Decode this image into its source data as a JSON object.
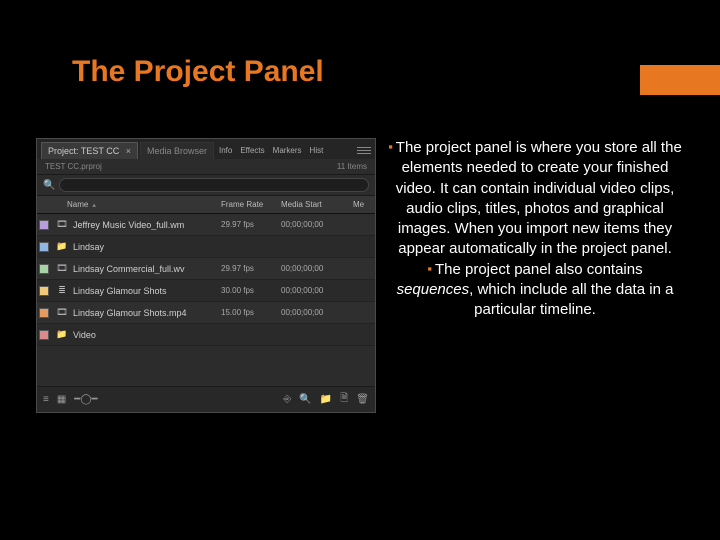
{
  "slide": {
    "title": "The Project Panel"
  },
  "panel": {
    "tabs": {
      "project": "Project: TEST CC",
      "browser": "Media Browser",
      "info": "Info",
      "effects": "Effects",
      "markers": "Markers",
      "history": "Hist"
    },
    "sub": {
      "file": "TEST CC.prproj",
      "count": "11 Items"
    },
    "search": {
      "placeholder": ""
    },
    "columns": {
      "name": "Name",
      "frame_rate": "Frame Rate",
      "media_start": "Media Start",
      "media_end": "Me"
    },
    "rows": [
      {
        "color": "#b89edb",
        "icon": "clip",
        "name": "Jeffrey Music Video_full.wm",
        "fr": "29.97 fps",
        "ms": "00;00;00;00"
      },
      {
        "color": "#8fb6e6",
        "icon": "bin",
        "name": "Lindsay",
        "fr": "",
        "ms": ""
      },
      {
        "color": "#a6d2a6",
        "icon": "clip",
        "name": "Lindsay Commercial_full.wv",
        "fr": "29.97 fps",
        "ms": "00;00;00;00"
      },
      {
        "color": "#f2c879",
        "icon": "seq",
        "name": "Lindsay Glamour Shots",
        "fr": "30.00 fps",
        "ms": "00;00;00;00"
      },
      {
        "color": "#e69c61",
        "icon": "clip",
        "name": "Lindsay Glamour Shots.mp4",
        "fr": "15.00 fps",
        "ms": "00;00;00;00"
      },
      {
        "color": "#d98a8a",
        "icon": "bin",
        "name": "Video",
        "fr": "",
        "ms": ""
      }
    ]
  },
  "text": {
    "b1a": "The project panel is where you store all the elements needed to create your finished video. It can contain individual video clips, audio clips, titles, photos and graphical images. When you import new items they appear automatically in the project panel.",
    "b2a": "The project panel also contains ",
    "b2b": "sequences",
    "b2c": ", which include all the data in a particular timeline."
  }
}
